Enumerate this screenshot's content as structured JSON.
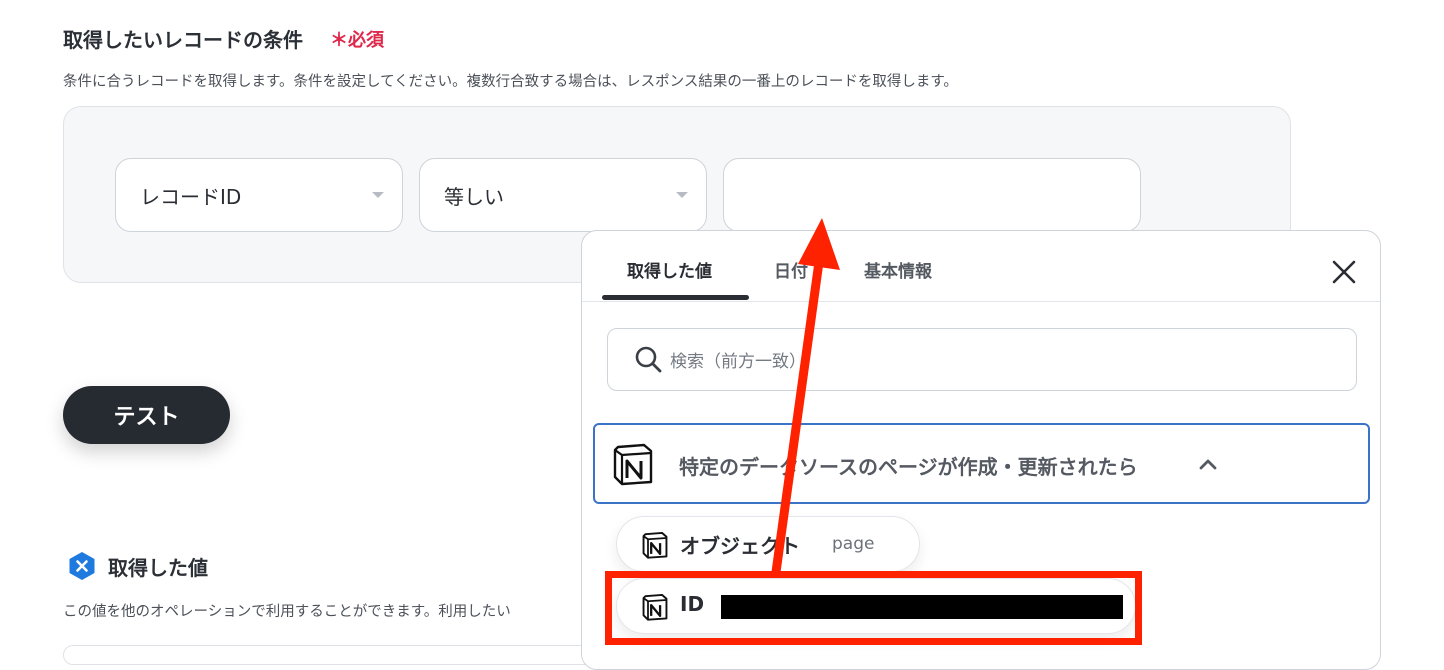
{
  "condition_section": {
    "title": "取得したいレコードの条件",
    "required_label": "＊必須",
    "description": "条件に合うレコードを取得します。条件を設定してください。複数行合致する場合は、レスポンス結果の一番上のレコードを取得します。",
    "field_select": "レコードID",
    "operator_select": "等しい",
    "value_input": ""
  },
  "test_button": "テスト",
  "acquired_value_section": {
    "title": "取得した値",
    "description": "この値を他のオペレーションで利用することができます。利用したい"
  },
  "popup": {
    "tabs": [
      {
        "label": "取得した値",
        "active": true
      },
      {
        "label": "日付",
        "active": false
      },
      {
        "label": "基本情報",
        "active": false
      }
    ],
    "search_placeholder": "検索（前方一致）",
    "trigger_group": "特定のデータソースのページが作成・更新されたら",
    "items": [
      {
        "name": "オブジェクト",
        "value": "page"
      },
      {
        "name": "ID",
        "value": ""
      }
    ]
  },
  "icons": [
    "notion-logo-icon",
    "search-icon",
    "close-icon",
    "chevron-up-icon",
    "yoom-logo-icon"
  ],
  "colors": {
    "required": "#e0284b",
    "dark_button": "#262a31",
    "trigger_border": "#3b73c7",
    "annotation": "#ff2200",
    "brand_blue": "#1f7ae0"
  }
}
